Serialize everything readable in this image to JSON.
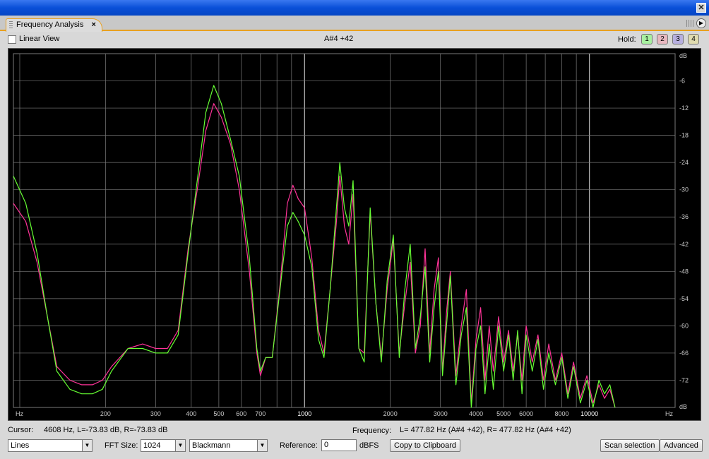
{
  "tab": {
    "title": "Frequency Analysis",
    "close": "×"
  },
  "toolbar": {
    "linear_view_label": "Linear View",
    "note_readout": "A#4 +42",
    "hold_label": "Hold:",
    "hold_buttons": [
      {
        "label": "1",
        "color": "#a8f0a0"
      },
      {
        "label": "2",
        "color": "#e8b8c0"
      },
      {
        "label": "3",
        "color": "#b8b0e0"
      },
      {
        "label": "4",
        "color": "#e0dcb0"
      }
    ]
  },
  "status": {
    "cursor_label": "Cursor:",
    "cursor_value": "4608 Hz, L=-73.83 dB, R=-73.83 dB",
    "frequency_label": "Frequency:",
    "frequency_value": "L= 477.82 Hz (A#4 +42), R= 477.82 Hz (A#4 +42)"
  },
  "controls": {
    "display_mode": "Lines",
    "fft_label": "FFT Size:",
    "fft_size": "1024",
    "window": "Blackmann",
    "reference_label": "Reference:",
    "reference_value": "0",
    "reference_unit": "dBFS",
    "copy_button": "Copy to Clipboard",
    "scan_button": "Scan selection",
    "advanced_button": "Advanced"
  },
  "colors": {
    "left_channel": "#66ff33",
    "right_channel": "#ff3399",
    "grid": "#7a7a7a",
    "plot_bg": "#000000"
  },
  "chart_data": {
    "type": "line",
    "xscale": "log",
    "xlim": [
      95,
      20000
    ],
    "ylim": [
      -78,
      0
    ],
    "xlabel": "Hz",
    "ylabel": "dB",
    "x_tick_labels": [
      {
        "value": 200,
        "label": "200"
      },
      {
        "value": 300,
        "label": "300"
      },
      {
        "value": 400,
        "label": "400"
      },
      {
        "value": 500,
        "label": "500"
      },
      {
        "value": 600,
        "label": "600"
      },
      {
        "value": 700,
        "label": "700"
      },
      {
        "value": 1000,
        "label": "1000"
      },
      {
        "value": 2000,
        "label": "2000"
      },
      {
        "value": 3000,
        "label": "3000"
      },
      {
        "value": 4000,
        "label": "4000"
      },
      {
        "value": 5000,
        "label": "5000"
      },
      {
        "value": 6000,
        "label": "6000"
      },
      {
        "value": 8000,
        "label": "8000"
      },
      {
        "value": 10000,
        "label": "10000"
      }
    ],
    "y_ticks": [
      -6,
      -12,
      -18,
      -24,
      -30,
      -36,
      -42,
      -48,
      -54,
      -60,
      -66,
      -72
    ],
    "grid": true,
    "series": [
      {
        "points": [
          [
            95,
            -27
          ],
          [
            105,
            -33
          ],
          [
            115,
            -44
          ],
          [
            125,
            -58
          ],
          [
            135,
            -70
          ],
          [
            150,
            -74
          ],
          [
            165,
            -75
          ],
          [
            180,
            -75
          ],
          [
            195,
            -74
          ],
          [
            210,
            -70
          ],
          [
            240,
            -65
          ],
          [
            270,
            -65
          ],
          [
            300,
            -66
          ],
          [
            330,
            -66
          ],
          [
            360,
            -62
          ],
          [
            390,
            -44
          ],
          [
            420,
            -28
          ],
          [
            450,
            -13
          ],
          [
            480,
            -7
          ],
          [
            510,
            -11
          ],
          [
            550,
            -19
          ],
          [
            590,
            -27
          ],
          [
            640,
            -45
          ],
          [
            680,
            -65
          ],
          [
            700,
            -70
          ],
          [
            730,
            -67
          ],
          [
            770,
            -67
          ],
          [
            820,
            -52
          ],
          [
            870,
            -38
          ],
          [
            910,
            -35
          ],
          [
            950,
            -37
          ],
          [
            1000,
            -40
          ],
          [
            1060,
            -47
          ],
          [
            1120,
            -63
          ],
          [
            1170,
            -67
          ],
          [
            1230,
            -52
          ],
          [
            1290,
            -35
          ],
          [
            1330,
            -24
          ],
          [
            1380,
            -34
          ],
          [
            1430,
            -38
          ],
          [
            1480,
            -28
          ],
          [
            1550,
            -65
          ],
          [
            1620,
            -68
          ],
          [
            1700,
            -34
          ],
          [
            1780,
            -55
          ],
          [
            1860,
            -68
          ],
          [
            1950,
            -50
          ],
          [
            2050,
            -40
          ],
          [
            2150,
            -67
          ],
          [
            2250,
            -52
          ],
          [
            2350,
            -42
          ],
          [
            2450,
            -65
          ],
          [
            2550,
            -58
          ],
          [
            2650,
            -47
          ],
          [
            2750,
            -68
          ],
          [
            2850,
            -56
          ],
          [
            2950,
            -48
          ],
          [
            3050,
            -71
          ],
          [
            3150,
            -60
          ],
          [
            3250,
            -49
          ],
          [
            3400,
            -73
          ],
          [
            3550,
            -62
          ],
          [
            3700,
            -56
          ],
          [
            3850,
            -78
          ],
          [
            4000,
            -65
          ],
          [
            4150,
            -60
          ],
          [
            4300,
            -75
          ],
          [
            4450,
            -64
          ],
          [
            4600,
            -74
          ],
          [
            4800,
            -60
          ],
          [
            5000,
            -70
          ],
          [
            5200,
            -62
          ],
          [
            5400,
            -72
          ],
          [
            5600,
            -61
          ],
          [
            5800,
            -75
          ],
          [
            6000,
            -62
          ],
          [
            6300,
            -70
          ],
          [
            6600,
            -63
          ],
          [
            6900,
            -74
          ],
          [
            7200,
            -66
          ],
          [
            7600,
            -73
          ],
          [
            8000,
            -67
          ],
          [
            8400,
            -76
          ],
          [
            8800,
            -69
          ],
          [
            9300,
            -77
          ],
          [
            9800,
            -72
          ],
          [
            10300,
            -78
          ],
          [
            10800,
            -72
          ],
          [
            11300,
            -75
          ],
          [
            11800,
            -73
          ],
          [
            12300,
            -78
          ]
        ]
      },
      {
        "points": [
          [
            95,
            -33
          ],
          [
            105,
            -37
          ],
          [
            115,
            -46
          ],
          [
            125,
            -58
          ],
          [
            135,
            -69
          ],
          [
            150,
            -72
          ],
          [
            165,
            -73
          ],
          [
            180,
            -73
          ],
          [
            195,
            -72
          ],
          [
            210,
            -69
          ],
          [
            240,
            -65
          ],
          [
            270,
            -64
          ],
          [
            300,
            -65
          ],
          [
            330,
            -65
          ],
          [
            360,
            -61
          ],
          [
            390,
            -43
          ],
          [
            420,
            -30
          ],
          [
            450,
            -17
          ],
          [
            480,
            -11
          ],
          [
            510,
            -14
          ],
          [
            550,
            -20
          ],
          [
            590,
            -30
          ],
          [
            640,
            -48
          ],
          [
            680,
            -66
          ],
          [
            700,
            -71
          ],
          [
            730,
            -67
          ],
          [
            770,
            -67
          ],
          [
            820,
            -51
          ],
          [
            870,
            -33
          ],
          [
            910,
            -29
          ],
          [
            950,
            -32
          ],
          [
            1000,
            -34
          ],
          [
            1060,
            -45
          ],
          [
            1120,
            -61
          ],
          [
            1170,
            -66
          ],
          [
            1230,
            -52
          ],
          [
            1290,
            -38
          ],
          [
            1330,
            -27
          ],
          [
            1380,
            -38
          ],
          [
            1430,
            -42
          ],
          [
            1480,
            -31
          ],
          [
            1550,
            -65
          ],
          [
            1620,
            -66
          ],
          [
            1700,
            -35
          ],
          [
            1780,
            -55
          ],
          [
            1860,
            -67
          ],
          [
            1950,
            -52
          ],
          [
            2050,
            -41
          ],
          [
            2150,
            -66
          ],
          [
            2250,
            -55
          ],
          [
            2350,
            -46
          ],
          [
            2450,
            -66
          ],
          [
            2550,
            -60
          ],
          [
            2650,
            -43
          ],
          [
            2750,
            -66
          ],
          [
            2850,
            -52
          ],
          [
            2950,
            -45
          ],
          [
            3050,
            -70
          ],
          [
            3150,
            -57
          ],
          [
            3250,
            -48
          ],
          [
            3400,
            -71
          ],
          [
            3550,
            -60
          ],
          [
            3700,
            -52
          ],
          [
            3850,
            -77
          ],
          [
            4000,
            -63
          ],
          [
            4150,
            -56
          ],
          [
            4300,
            -72
          ],
          [
            4450,
            -60
          ],
          [
            4600,
            -70
          ],
          [
            4800,
            -58
          ],
          [
            5000,
            -68
          ],
          [
            5200,
            -61
          ],
          [
            5400,
            -70
          ],
          [
            5600,
            -62
          ],
          [
            5800,
            -72
          ],
          [
            6000,
            -60
          ],
          [
            6300,
            -68
          ],
          [
            6600,
            -62
          ],
          [
            6900,
            -72
          ],
          [
            7200,
            -64
          ],
          [
            7600,
            -72
          ],
          [
            8000,
            -66
          ],
          [
            8400,
            -75
          ],
          [
            8800,
            -68
          ],
          [
            9300,
            -76
          ],
          [
            9800,
            -71
          ],
          [
            10300,
            -77
          ],
          [
            10800,
            -73
          ],
          [
            11300,
            -76
          ],
          [
            11800,
            -74
          ],
          [
            12300,
            -78
          ]
        ]
      }
    ]
  }
}
